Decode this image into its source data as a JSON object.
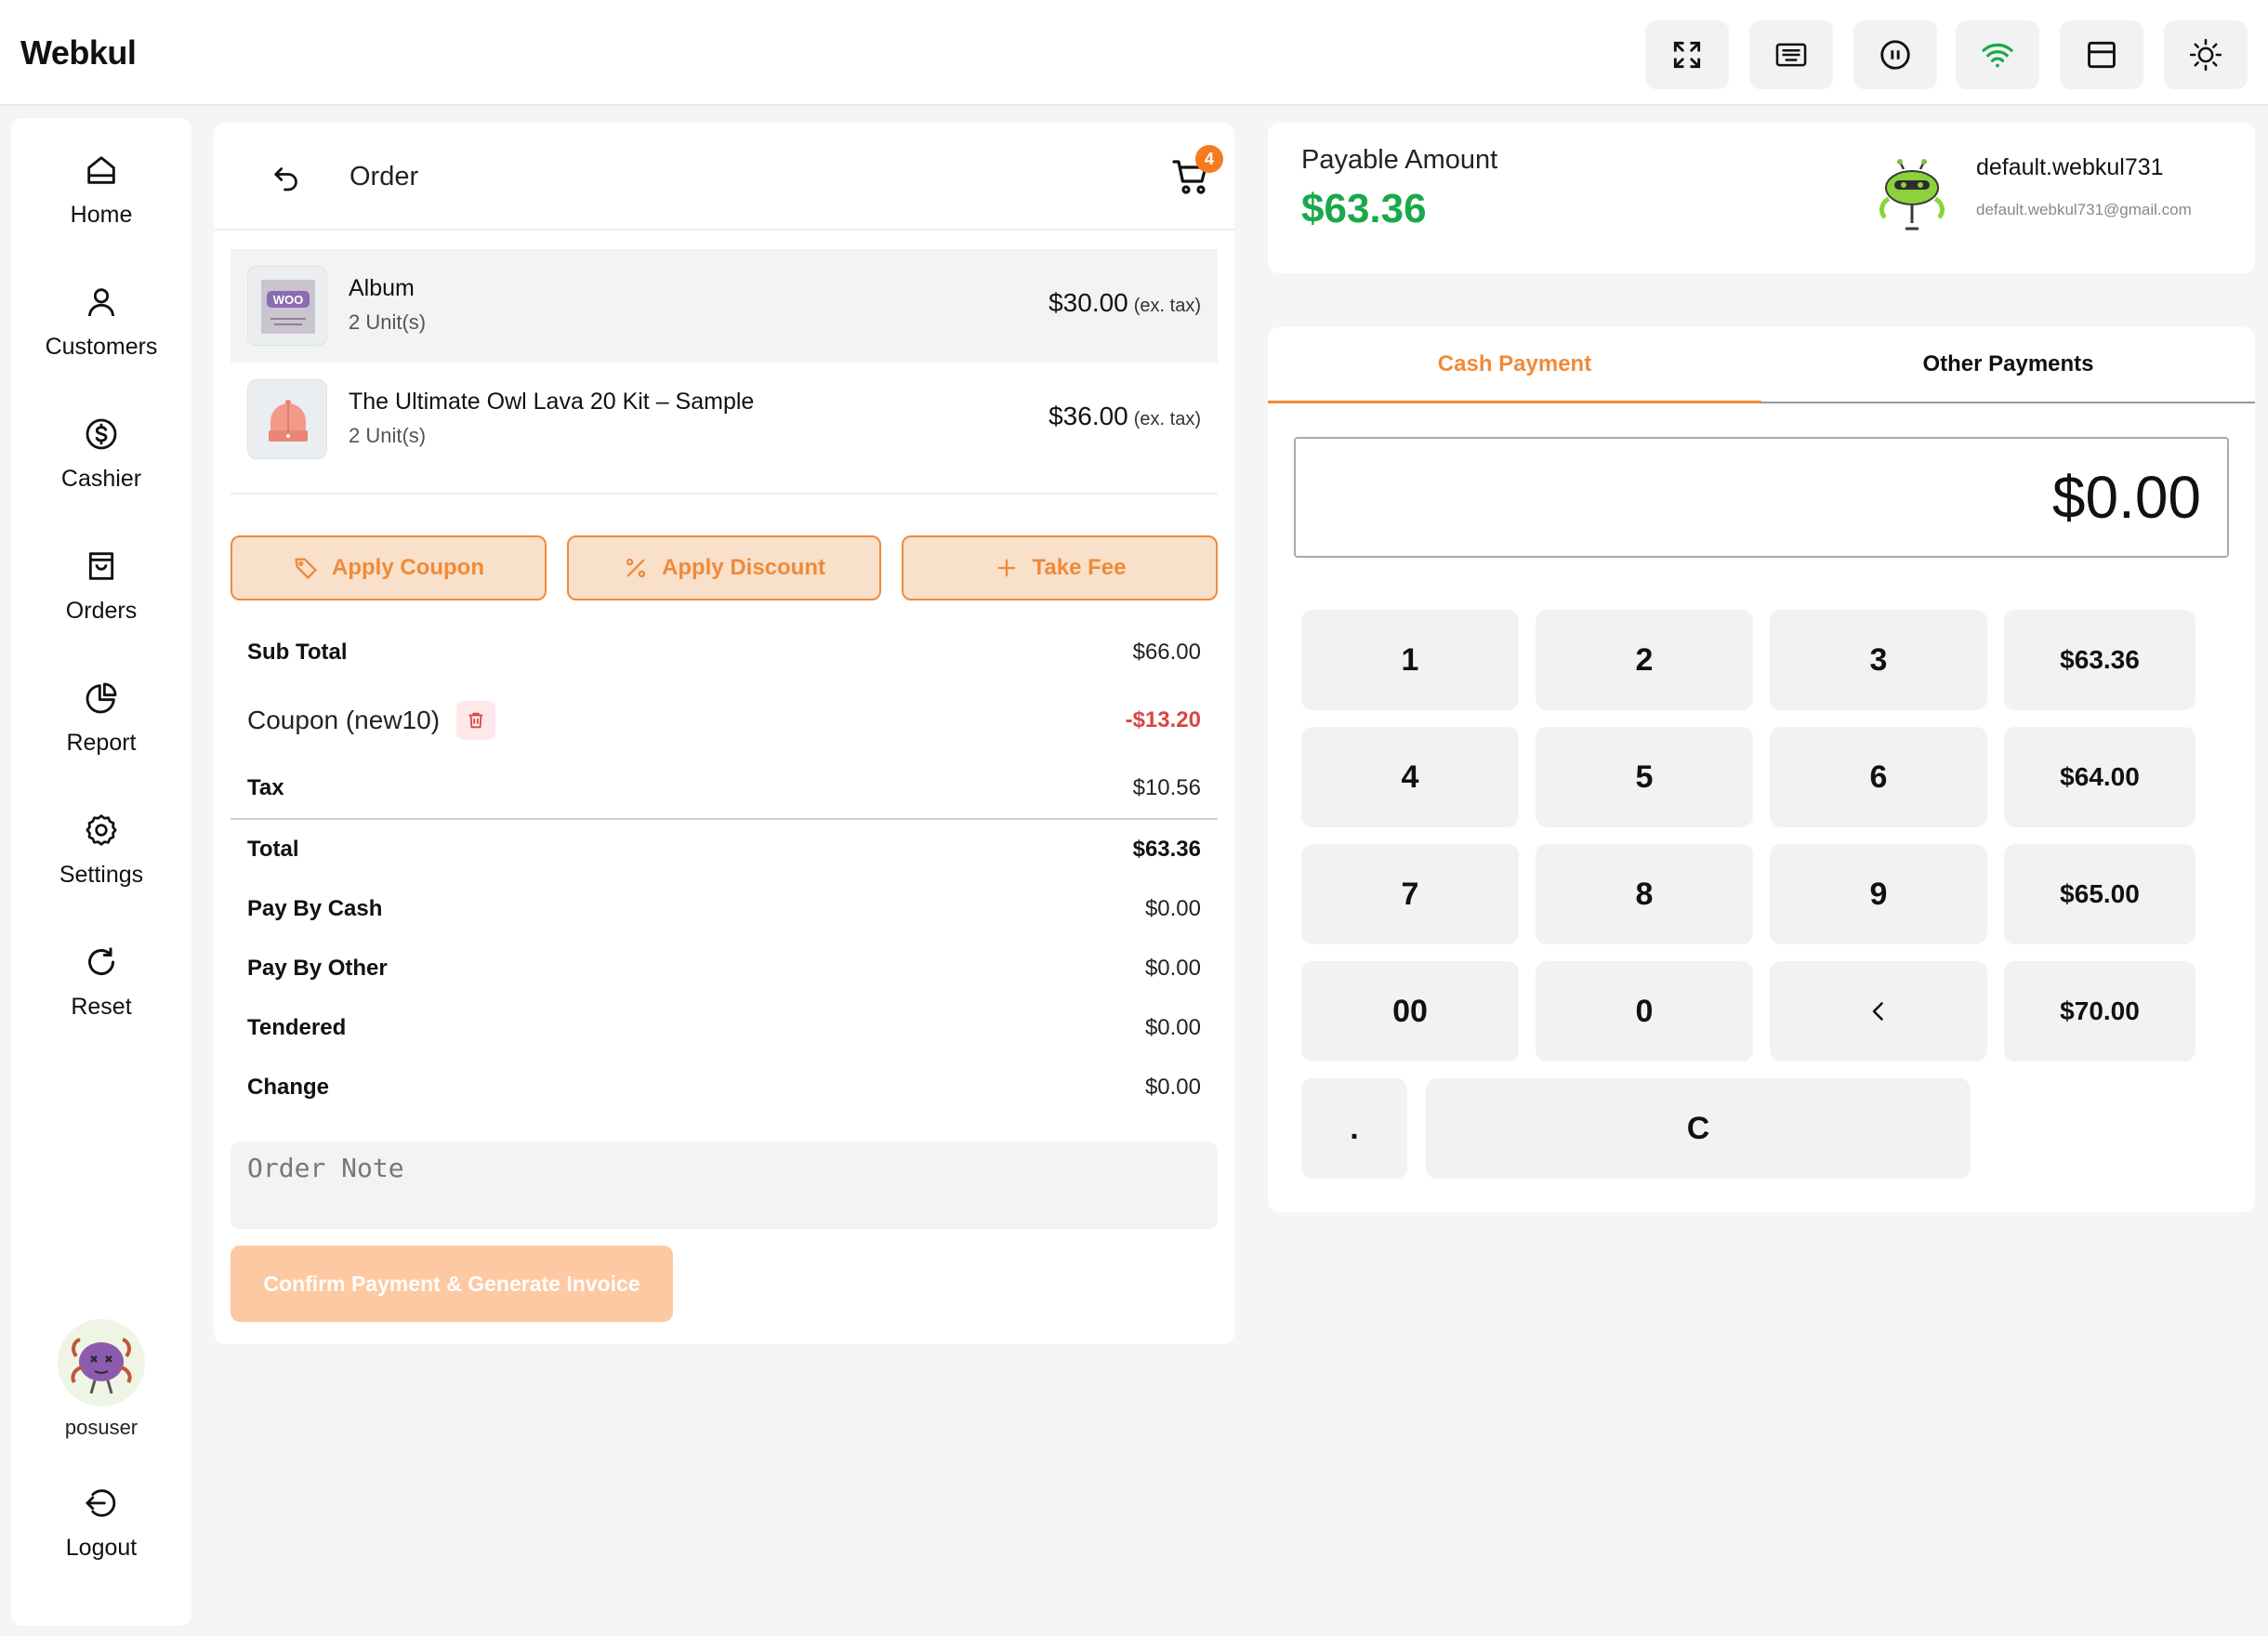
{
  "header": {
    "brand": "Webkul",
    "buttons": [
      {
        "name": "fullscreen-button",
        "icon": "expand-icon"
      },
      {
        "name": "keyboard-button",
        "icon": "keyboard-icon"
      },
      {
        "name": "hold-button",
        "icon": "pause-icon"
      },
      {
        "name": "wifi-button",
        "icon": "wifi-icon",
        "color": "#1aa84b"
      },
      {
        "name": "layout-button",
        "icon": "layout-icon"
      },
      {
        "name": "theme-button",
        "icon": "sun-icon"
      }
    ]
  },
  "sidebar": {
    "items": [
      {
        "label": "Home",
        "icon": "home-icon"
      },
      {
        "label": "Customers",
        "icon": "user-icon"
      },
      {
        "label": "Cashier",
        "icon": "dollar-circle-icon"
      },
      {
        "label": "Orders",
        "icon": "bag-icon"
      },
      {
        "label": "Report",
        "icon": "pie-chart-icon"
      },
      {
        "label": "Settings",
        "icon": "gear-icon"
      },
      {
        "label": "Reset",
        "icon": "refresh-icon"
      }
    ],
    "user": "posuser",
    "logout": "Logout"
  },
  "order": {
    "title": "Order",
    "cart_count": "4",
    "items": [
      {
        "name": "Album",
        "qty": "2 Unit(s)",
        "price": "$30.00",
        "tax_note": "(ex. tax)"
      },
      {
        "name": "The Ultimate Owl Lava 20 Kit – Sample",
        "qty": "2 Unit(s)",
        "price": "$36.00",
        "tax_note": "(ex. tax)"
      }
    ],
    "actions": {
      "coupon": "Apply Coupon",
      "discount": "Apply Discount",
      "fee": "Take Fee"
    },
    "summary": {
      "subtotal_label": "Sub Total",
      "subtotal": "$66.00",
      "coupon_label": "Coupon (new10)",
      "coupon": "-$13.20",
      "tax_label": "Tax",
      "tax": "$10.56",
      "total_label": "Total",
      "total": "$63.36",
      "cash_label": "Pay By Cash",
      "cash": "$0.00",
      "other_label": "Pay By Other",
      "other": "$0.00",
      "tendered_label": "Tendered",
      "tendered": "$0.00",
      "change_label": "Change",
      "change": "$0.00"
    },
    "note_placeholder": "Order Note",
    "confirm_label": "Confirm Payment & Generate Invoice"
  },
  "payable": {
    "label": "Payable Amount",
    "amount": "$63.36",
    "customer_name": "default.webkul731",
    "customer_email": "default.webkul731@gmail.com"
  },
  "payment": {
    "tabs": [
      "Cash Payment",
      "Other Payments"
    ],
    "cash_value": "$0.00",
    "keys": {
      "k1": "1",
      "k2": "2",
      "k3": "3",
      "k4": "4",
      "k5": "5",
      "k6": "6",
      "k7": "7",
      "k8": "8",
      "k9": "9",
      "k00": "00",
      "k0": "0",
      "kdot": ".",
      "kclear": "C"
    },
    "quick_amounts": [
      "$63.36",
      "$64.00",
      "$65.00",
      "$70.00"
    ]
  },
  "colors": {
    "accent": "#f08a38",
    "success": "#1aa84b",
    "danger": "#d94646",
    "badge": "#f47c1f"
  }
}
